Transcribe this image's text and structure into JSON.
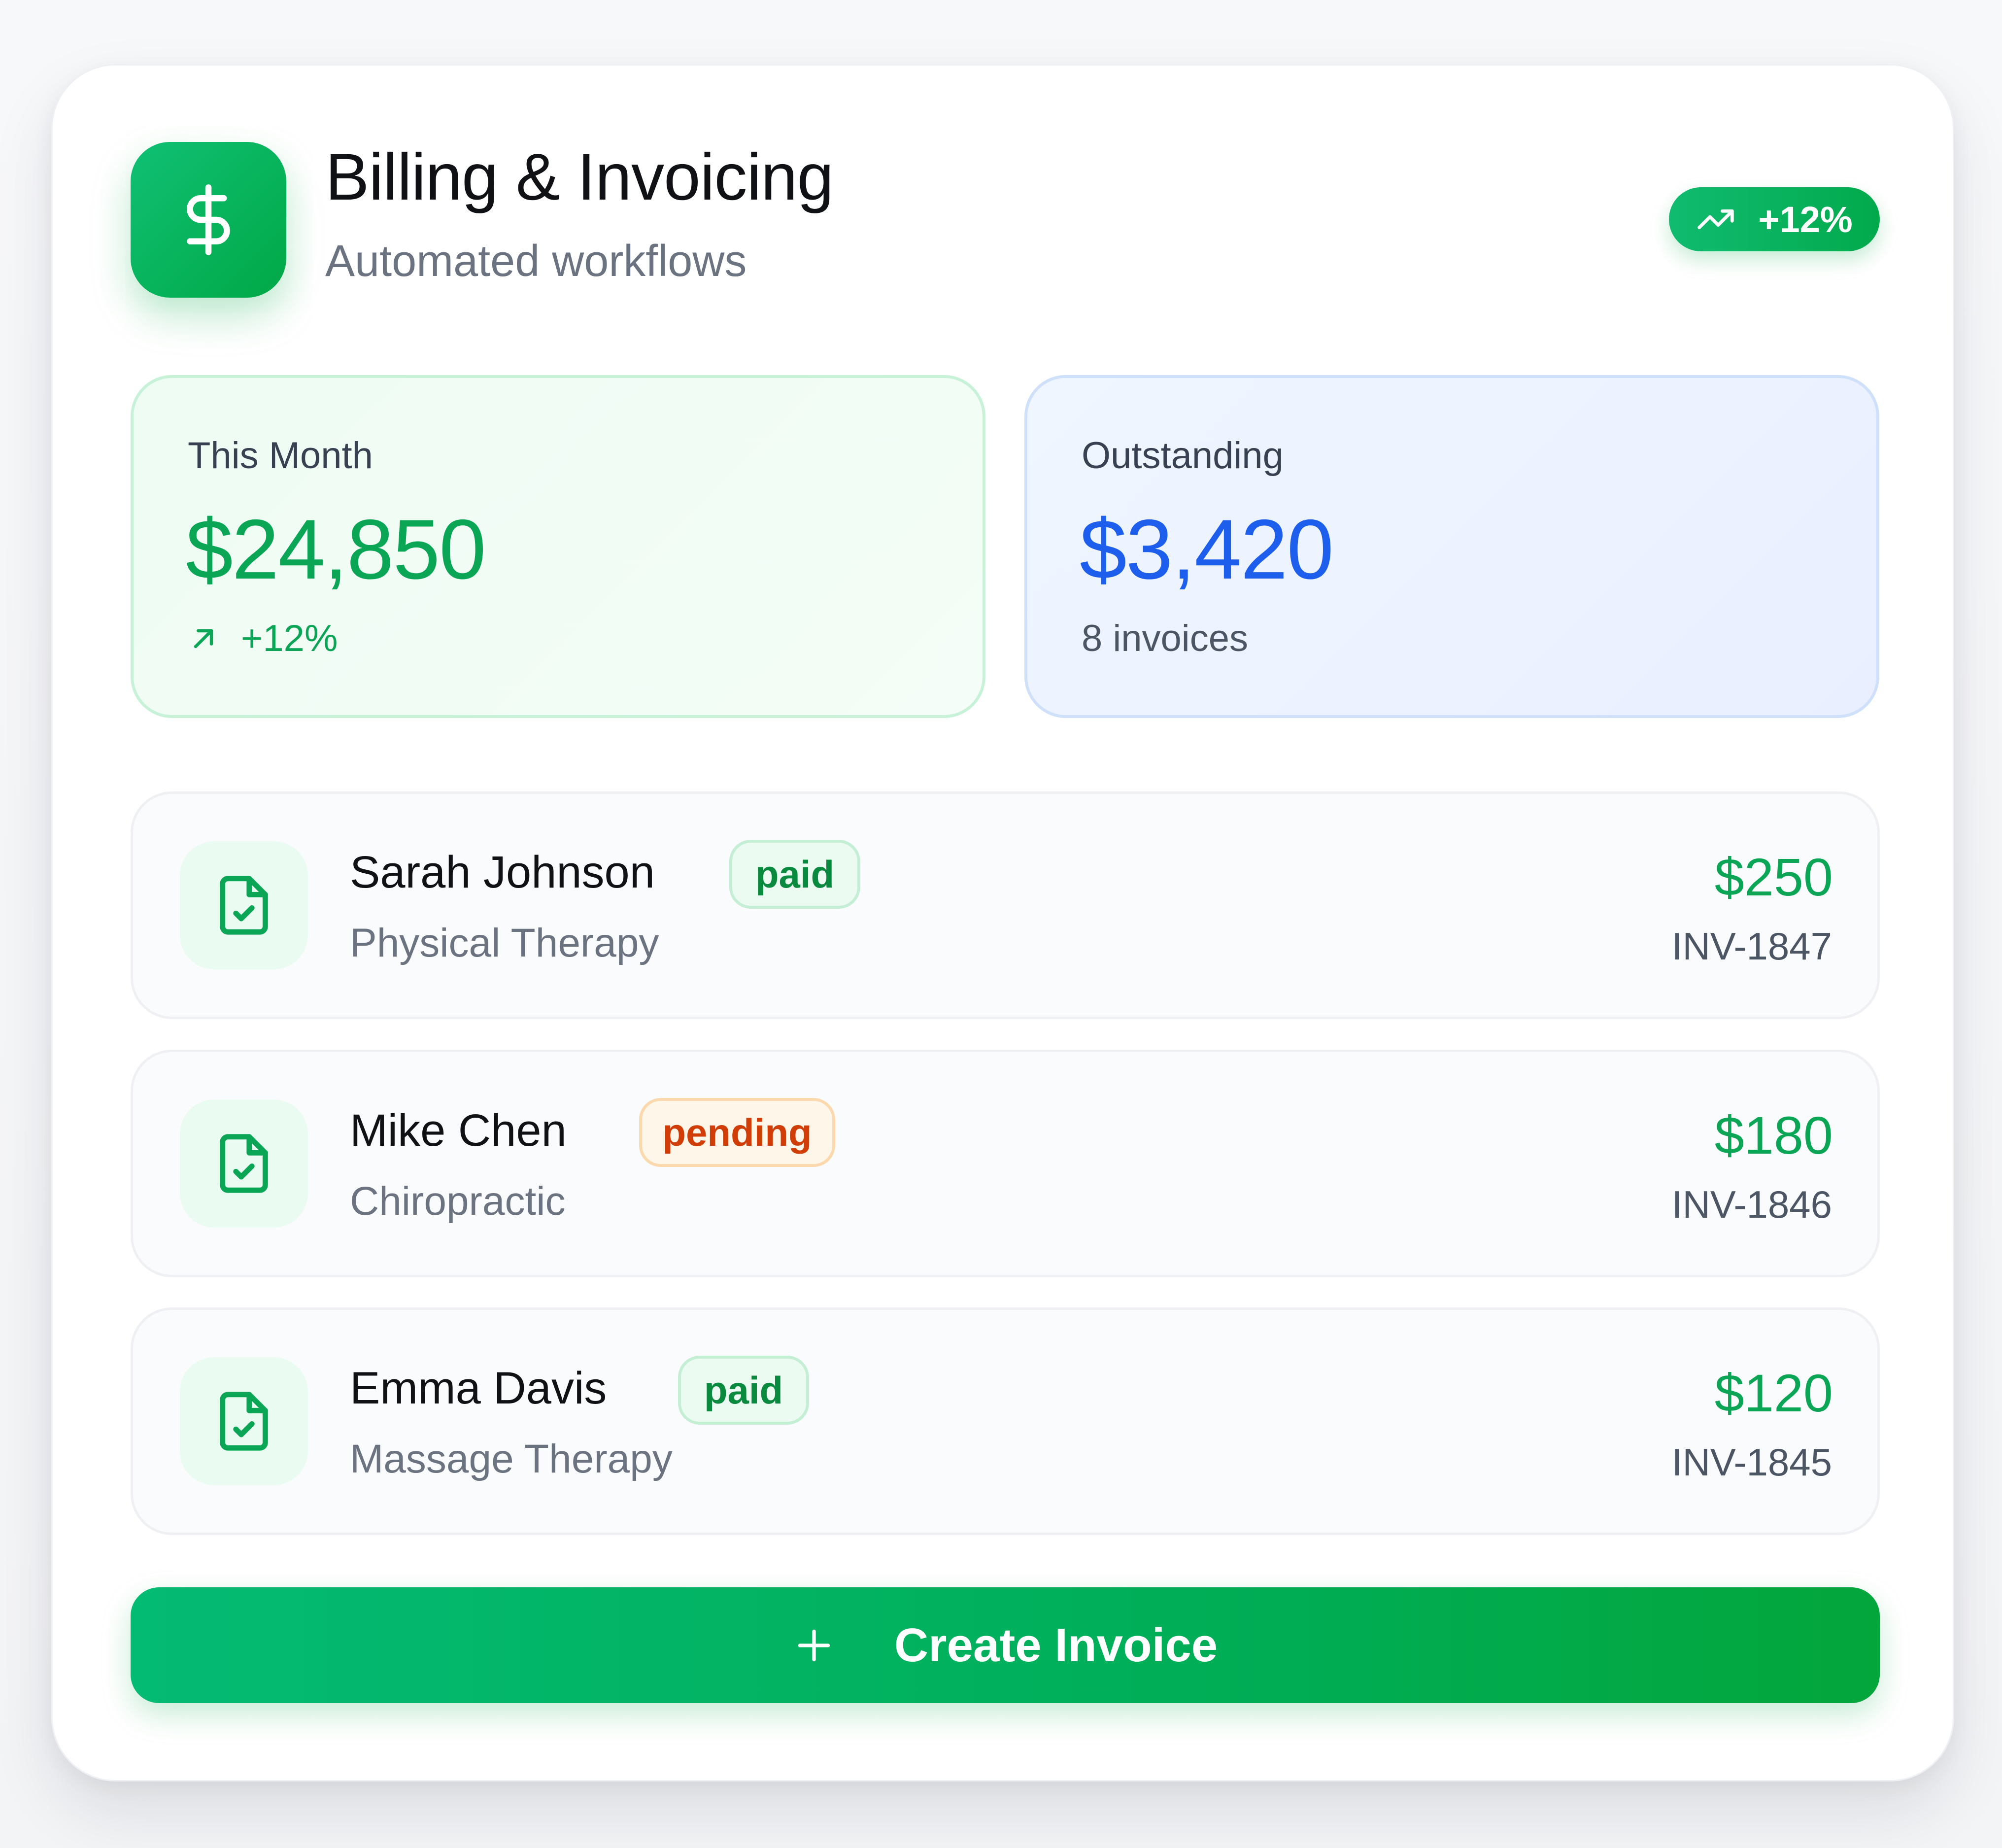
{
  "header": {
    "title": "Billing & Invoicing",
    "subtitle": "Automated workflows",
    "icon": "dollar-icon",
    "trend_badge": "+12%",
    "trend_icon": "trending-up-icon"
  },
  "stats": {
    "this_month": {
      "label": "This Month",
      "value": "$24,850",
      "change": "+12%",
      "change_icon": "arrow-up-right-icon"
    },
    "outstanding": {
      "label": "Outstanding",
      "value": "$3,420",
      "sub": "8 invoices"
    }
  },
  "invoices": [
    {
      "name": "Sarah Johnson",
      "status": "paid",
      "service": "Physical Therapy",
      "amount": "$250",
      "invoice_id": "INV-1847",
      "icon": "file-check-icon"
    },
    {
      "name": "Mike Chen",
      "status": "pending",
      "service": "Chiropractic",
      "amount": "$180",
      "invoice_id": "INV-1846",
      "icon": "file-check-icon"
    },
    {
      "name": "Emma Davis",
      "status": "paid",
      "service": "Massage Therapy",
      "amount": "$120",
      "invoice_id": "INV-1845",
      "icon": "file-check-icon"
    }
  ],
  "actions": {
    "create_label": "Create Invoice",
    "create_icon": "plus-icon"
  },
  "colors": {
    "brand_green": "#00a846",
    "accent_blue": "#1d5fec",
    "pending_orange": "#d13d06",
    "paid_green": "#0a8a3e"
  }
}
